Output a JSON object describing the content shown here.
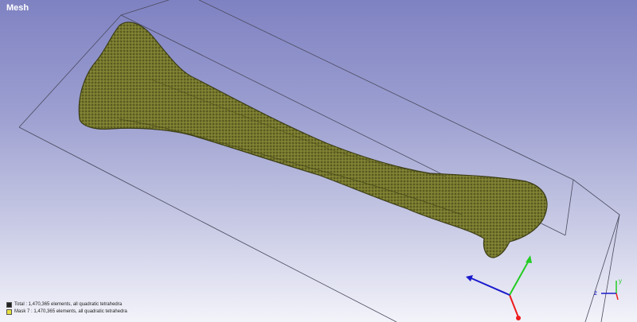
{
  "view": {
    "title": "Mesh"
  },
  "legend": [
    {
      "text": "Total : 1,470,365 elements, all quadratic tetrahedra",
      "color": "#222222"
    },
    {
      "text": "Mask 7 : 1,470,365 elements, all quadratic tetrahedra",
      "color": "#e8e040"
    }
  ],
  "colors": {
    "mesh_fill": "#76782c",
    "mesh_edge": "#3c3d16",
    "mesh_highlight": "#d6d86a",
    "bounding_box": "#4a4a5e",
    "axis_x": "#ee1a1a",
    "axis_y": "#22cc22",
    "axis_z": "#1a1acc"
  },
  "mini_axes": {
    "y_label": "y",
    "z_label": "z"
  }
}
